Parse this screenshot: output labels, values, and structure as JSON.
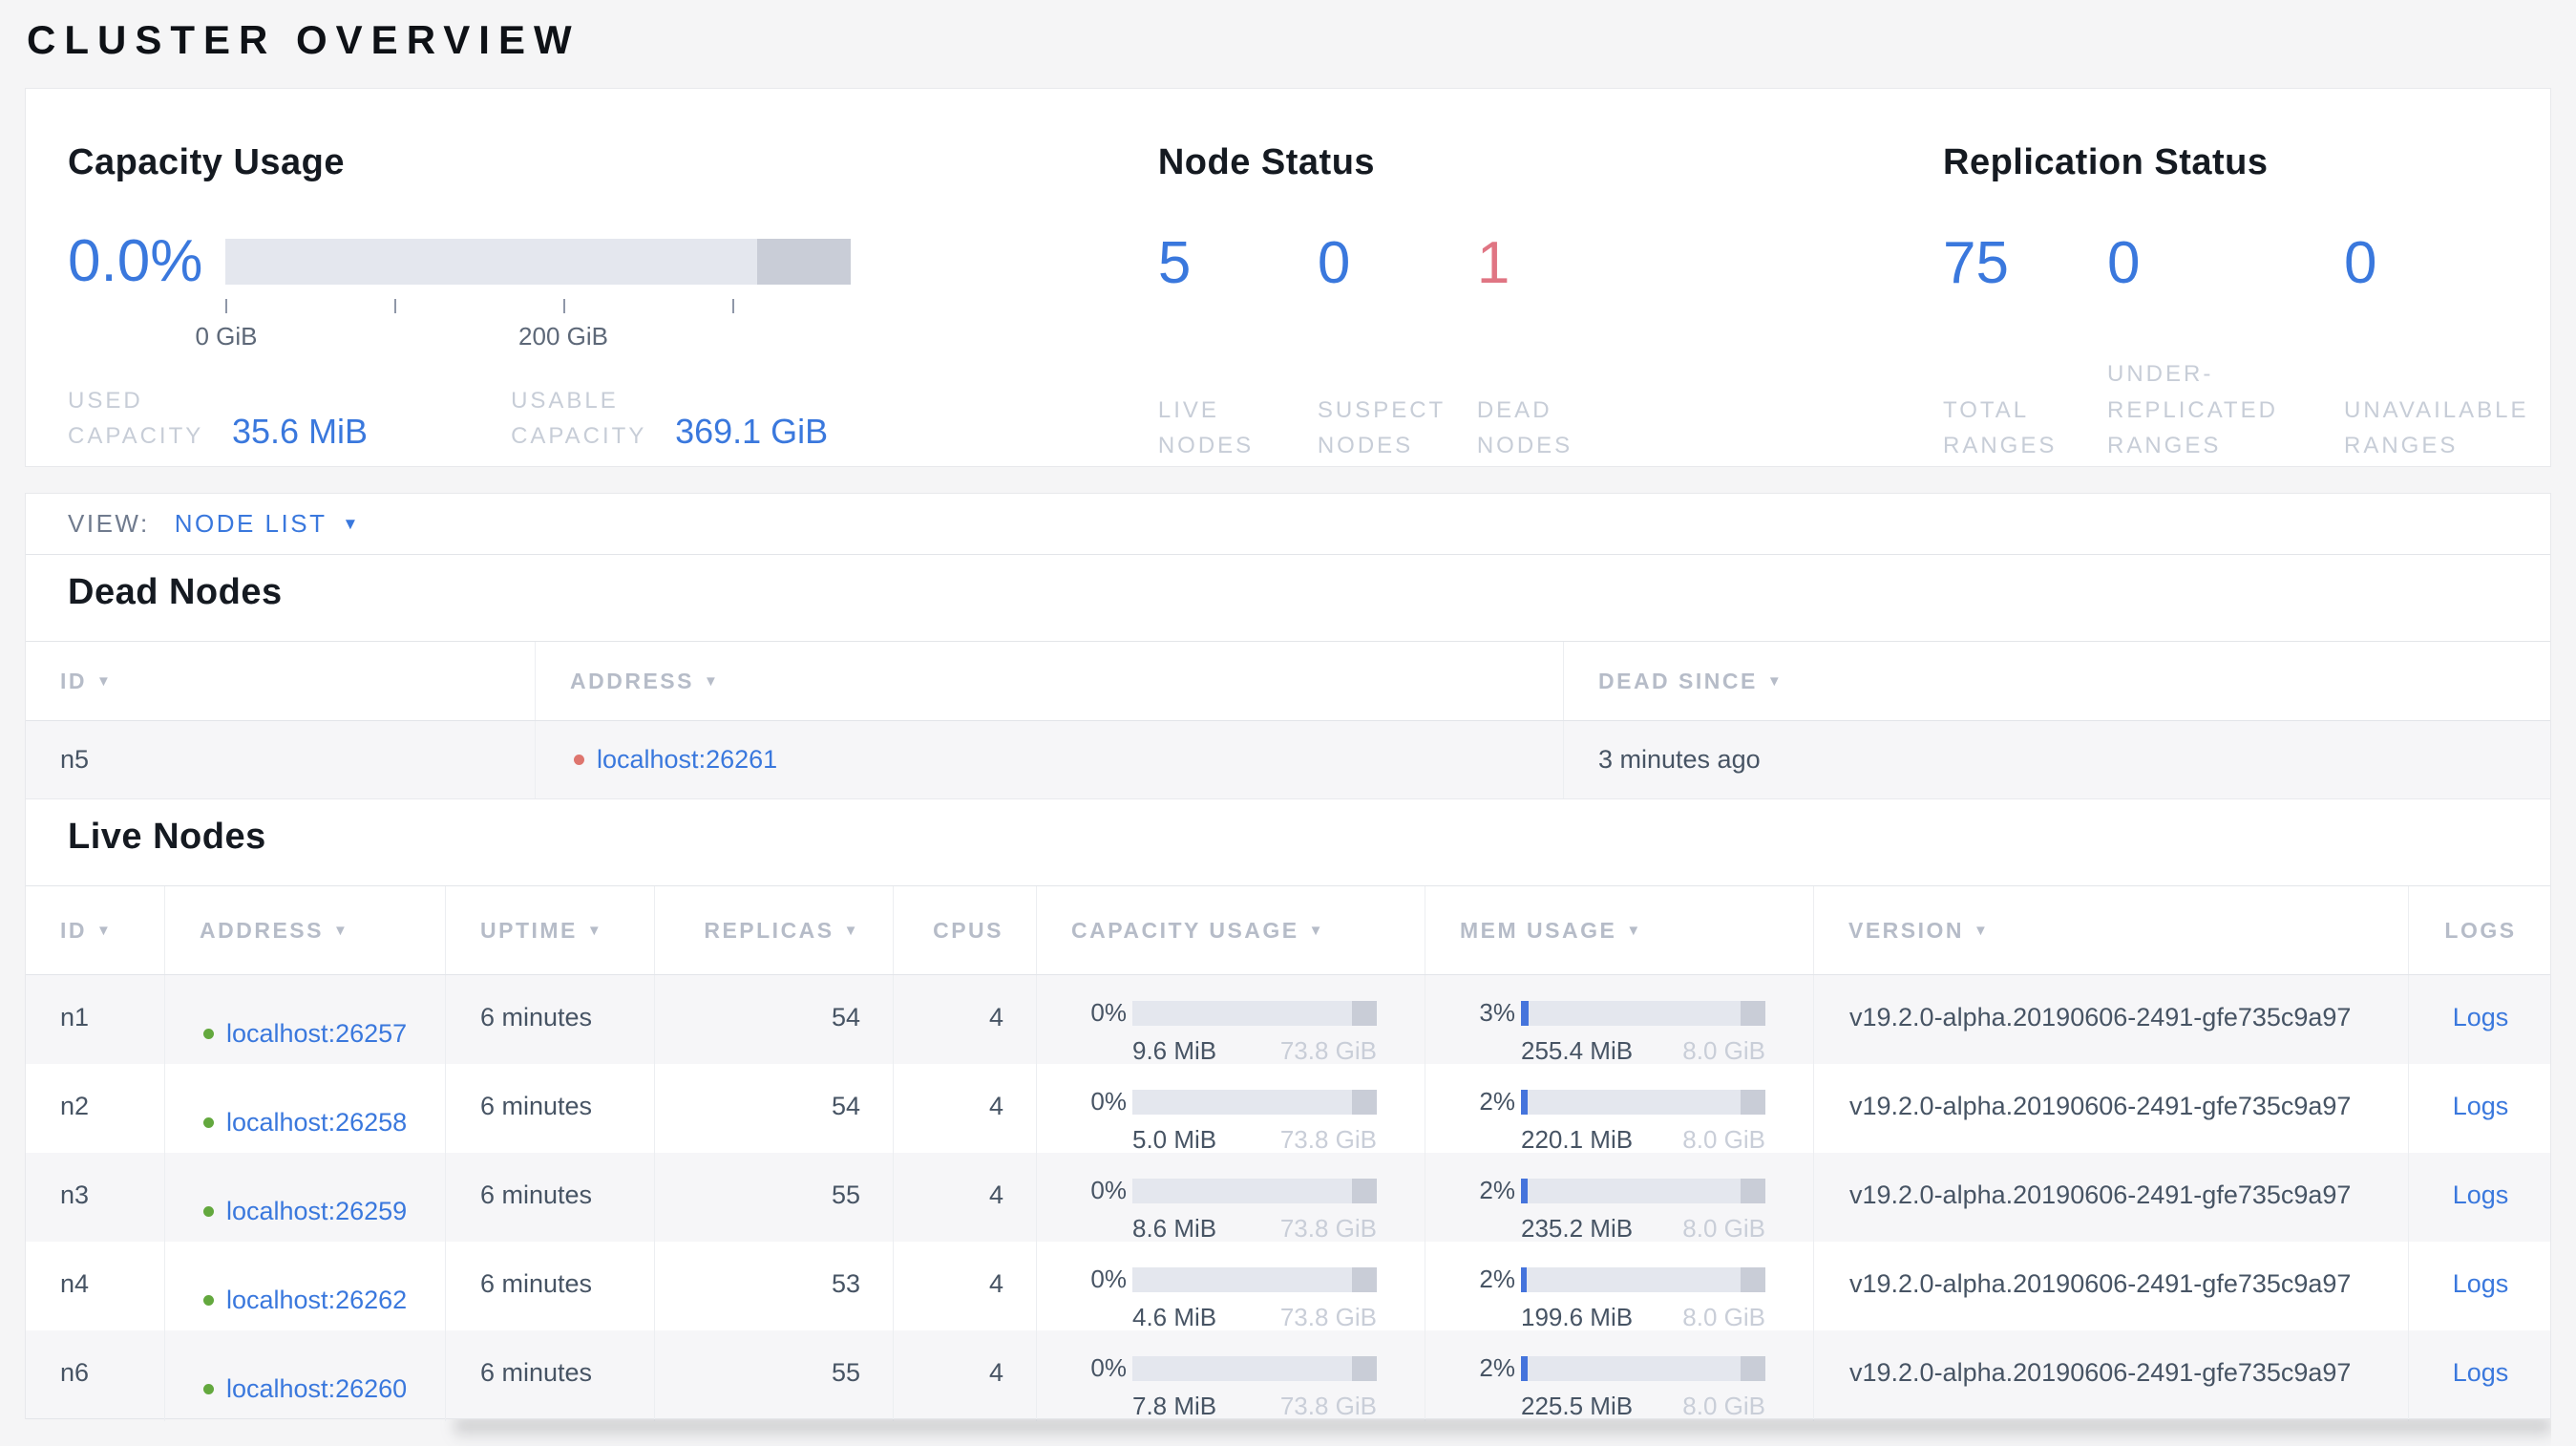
{
  "page": {
    "title": "CLUSTER OVERVIEW"
  },
  "colors": {
    "accent_blue": "#3a78dd",
    "dead_red": "#e07583",
    "live_green": "#63a83e"
  },
  "summary": {
    "capacity": {
      "title": "Capacity Usage",
      "percent": "0.0%",
      "bar": {
        "used_pct": 0,
        "other_pct": 15
      },
      "ticks": [
        {
          "label": "0 GiB"
        },
        {
          "label": ""
        },
        {
          "label": "200 GiB"
        },
        {
          "label": ""
        }
      ],
      "stats": [
        {
          "label": "USED\nCAPACITY",
          "value": "35.6 MiB"
        },
        {
          "label": "USABLE\nCAPACITY",
          "value": "369.1 GiB"
        }
      ]
    },
    "node_status": {
      "title": "Node Status",
      "stats": [
        {
          "value": "5",
          "label": "LIVE\nNODES",
          "color": "#3a78dd"
        },
        {
          "value": "0",
          "label": "SUSPECT\nNODES",
          "color": "#3a78dd"
        },
        {
          "value": "1",
          "label": "DEAD\nNODES",
          "color": "#e07583"
        }
      ]
    },
    "replication": {
      "title": "Replication Status",
      "stats": [
        {
          "value": "75",
          "label": "TOTAL\nRANGES",
          "color": "#3a78dd"
        },
        {
          "value": "0",
          "label": "UNDER-\nREPLICATED\nRANGES",
          "color": "#3a78dd"
        },
        {
          "value": "0",
          "label": "UNAVAILABLE\nRANGES",
          "color": "#3a78dd"
        }
      ]
    }
  },
  "view_bar": {
    "label": "VIEW:",
    "selected": "NODE LIST",
    "caret": "▼"
  },
  "dead_nodes": {
    "title": "Dead Nodes",
    "columns": [
      {
        "label": "ID",
        "arrow": "▼"
      },
      {
        "label": "ADDRESS",
        "arrow": "▼"
      },
      {
        "label": "DEAD SINCE",
        "arrow": "▼"
      }
    ],
    "rows": [
      {
        "id": "n5",
        "address": "localhost:26261",
        "dead_since": "3 minutes ago"
      }
    ]
  },
  "live_nodes": {
    "title": "Live Nodes",
    "columns": [
      {
        "label": "ID",
        "arrow": "▼"
      },
      {
        "label": "ADDRESS",
        "arrow": "▼"
      },
      {
        "label": "UPTIME",
        "arrow": "▼"
      },
      {
        "label": "REPLICAS",
        "arrow": "▼"
      },
      {
        "label": "CPUS",
        "arrow": ""
      },
      {
        "label": "CAPACITY USAGE",
        "arrow": "▼"
      },
      {
        "label": "MEM USAGE",
        "arrow": "▼"
      },
      {
        "label": "VERSION",
        "arrow": "▼"
      },
      {
        "label": "LOGS",
        "arrow": ""
      }
    ],
    "rows": [
      {
        "id": "n1",
        "address": "localhost:26257",
        "uptime": "6 minutes",
        "replicas": "54",
        "cpus": "4",
        "capacity": {
          "percent": "0%",
          "used": "9.6 MiB",
          "total": "73.8 GiB",
          "used_pct": 0,
          "other_pct": 10
        },
        "memory": {
          "percent": "3%",
          "used": "255.4 MiB",
          "total": "8.0 GiB",
          "used_pct": 3,
          "other_pct": 10
        },
        "version": "v19.2.0-alpha.20190606-2491-gfe735c9a97",
        "logs": "Logs"
      },
      {
        "id": "n2",
        "address": "localhost:26258",
        "uptime": "6 minutes",
        "replicas": "54",
        "cpus": "4",
        "capacity": {
          "percent": "0%",
          "used": "5.0 MiB",
          "total": "73.8 GiB",
          "used_pct": 0,
          "other_pct": 10
        },
        "memory": {
          "percent": "2%",
          "used": "220.1 MiB",
          "total": "8.0 GiB",
          "used_pct": 2.7,
          "other_pct": 10
        },
        "version": "v19.2.0-alpha.20190606-2491-gfe735c9a97",
        "logs": "Logs"
      },
      {
        "id": "n3",
        "address": "localhost:26259",
        "uptime": "6 minutes",
        "replicas": "55",
        "cpus": "4",
        "capacity": {
          "percent": "0%",
          "used": "8.6 MiB",
          "total": "73.8 GiB",
          "used_pct": 0,
          "other_pct": 10
        },
        "memory": {
          "percent": "2%",
          "used": "235.2 MiB",
          "total": "8.0 GiB",
          "used_pct": 2.9,
          "other_pct": 10
        },
        "version": "v19.2.0-alpha.20190606-2491-gfe735c9a97",
        "logs": "Logs"
      },
      {
        "id": "n4",
        "address": "localhost:26262",
        "uptime": "6 minutes",
        "replicas": "53",
        "cpus": "4",
        "capacity": {
          "percent": "0%",
          "used": "4.6 MiB",
          "total": "73.8 GiB",
          "used_pct": 0,
          "other_pct": 10
        },
        "memory": {
          "percent": "2%",
          "used": "199.6 MiB",
          "total": "8.0 GiB",
          "used_pct": 2.4,
          "other_pct": 10
        },
        "version": "v19.2.0-alpha.20190606-2491-gfe735c9a97",
        "logs": "Logs"
      },
      {
        "id": "n6",
        "address": "localhost:26260",
        "uptime": "6 minutes",
        "replicas": "55",
        "cpus": "4",
        "capacity": {
          "percent": "0%",
          "used": "7.8 MiB",
          "total": "73.8 GiB",
          "used_pct": 0,
          "other_pct": 10
        },
        "memory": {
          "percent": "2%",
          "used": "225.5 MiB",
          "total": "8.0 GiB",
          "used_pct": 2.8,
          "other_pct": 10
        },
        "version": "v19.2.0-alpha.20190606-2491-gfe735c9a97",
        "logs": "Logs"
      }
    ]
  }
}
